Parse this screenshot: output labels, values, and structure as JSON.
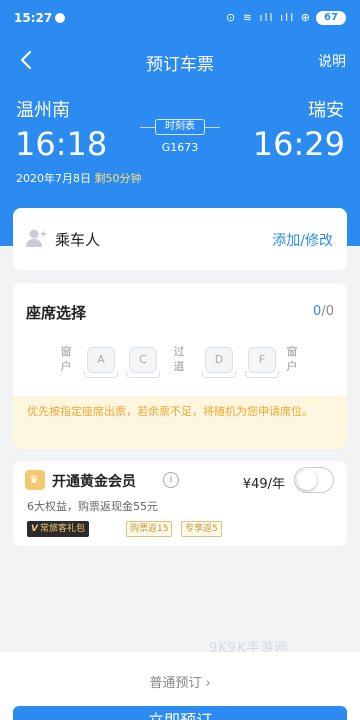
{
  "status_bar": {
    "time": "15:27",
    "indicators": "⊙ ≋ ıll ıll ⊕",
    "battery": "67"
  },
  "nav": {
    "title": "预订车票",
    "explain_label": "说明"
  },
  "trip": {
    "from_station": "温州南",
    "to_station": "瑞安",
    "depart_time": "16:18",
    "arrive_time": "16:29",
    "schedule_label": "时刻表",
    "train_no": "G1673",
    "date": "2020年7月8日",
    "duration": "剩50分钟"
  },
  "passenger": {
    "label": "乘车人",
    "edit_label": "添加/修改"
  },
  "seat_selection": {
    "title": "座席选择",
    "selected": "0",
    "separator": "/",
    "total": "0",
    "window_left": "窗户",
    "aisle": "过道",
    "window_right": "窗户",
    "seats": [
      "A",
      "C",
      "D",
      "F"
    ],
    "notice": "优先按指定座席出票，若余票不足，将随机为您申请席位。"
  },
  "vip": {
    "crown_glyph": "♛",
    "name": "开通黄金会员",
    "info_glyph": "i",
    "price": "¥49/年",
    "desc": "6大权益，购票返现金55元",
    "tags": [
      "常旅客礼包",
      "购票返15",
      "专享返5"
    ],
    "tag_badge": "V"
  },
  "watermark": "9K9K手游网",
  "footer": {
    "normal_booking": "普通预订 ›",
    "submit_label": "立即预订"
  },
  "colors": {
    "primary": "#2b8bf0",
    "notice_bg": "#fff6e0",
    "notice_text": "#f0a830",
    "gold": "#f4c871"
  }
}
